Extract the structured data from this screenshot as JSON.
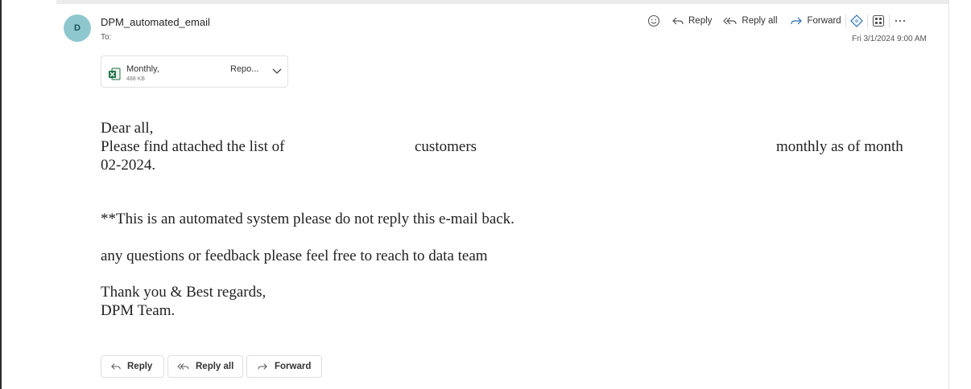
{
  "email": {
    "sender_name": "DPM_automated_email",
    "avatar_initial": "D",
    "to_label": "To:",
    "date": "Fri 3/1/2024 9:00 AM"
  },
  "toolbar": {
    "reply_label": "Reply",
    "reply_all_label": "Reply all",
    "forward_label": "Forward",
    "icons": [
      "emoji-icon",
      "reply-icon",
      "reply-all-icon",
      "forward-icon",
      "loop-icon",
      "grid-apps-icon",
      "more-icon"
    ]
  },
  "attachment": {
    "name_part1": "Monthly,",
    "name_part2": "Repo...",
    "size": "488 KB",
    "file_type_icon": "excel-icon"
  },
  "body": {
    "greeting": "Dear all,",
    "line1_part1": "Please find attached the list of",
    "line1_part2": "customers",
    "line1_part3": "monthly as of month",
    "line2": "02-2024.",
    "notice": "**This is an automated system please do not reply this e-mail back.",
    "questions": "any questions or feedback please feel free to reach to data team",
    "closing": "Thank you & Best regards,",
    "signature": "DPM Team."
  },
  "footer_buttons": {
    "reply_label": "Reply",
    "reply_all_label": "Reply all",
    "forward_label": "Forward"
  },
  "colors": {
    "avatar_bg": "#8fc7cf",
    "accent_blue": "#2b6cb0",
    "excel_green": "#1e7145"
  }
}
